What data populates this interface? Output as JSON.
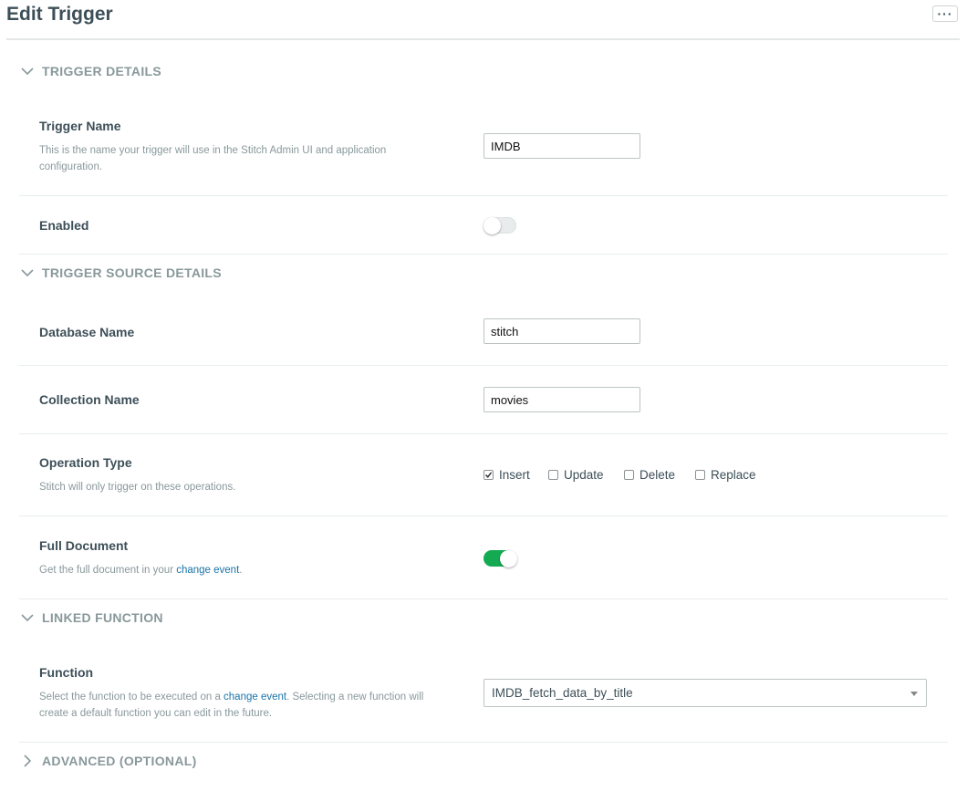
{
  "header": {
    "title": "Edit Trigger",
    "more_label": "···"
  },
  "sections": {
    "trigger_details": "TRIGGER DETAILS",
    "trigger_source": "TRIGGER SOURCE DETAILS",
    "linked_function": "LINKED FUNCTION",
    "advanced": "ADVANCED (OPTIONAL)"
  },
  "trigger_name": {
    "label": "Trigger Name",
    "description": "This is the name your trigger will use in the Stitch Admin UI and application configuration.",
    "value": "IMDB"
  },
  "enabled": {
    "label": "Enabled",
    "on": false
  },
  "database_name": {
    "label": "Database Name",
    "value": "stitch"
  },
  "collection_name": {
    "label": "Collection Name",
    "value": "movies"
  },
  "operation_type": {
    "label": "Operation Type",
    "description": "Stitch will only trigger on these operations.",
    "options": [
      {
        "label": "Insert",
        "checked": true
      },
      {
        "label": "Update",
        "checked": false
      },
      {
        "label": "Delete",
        "checked": false
      },
      {
        "label": "Replace",
        "checked": false
      }
    ]
  },
  "full_document": {
    "label": "Full Document",
    "description_prefix": "Get the full document in your ",
    "link_text": "change event",
    "description_suffix": ".",
    "on": true
  },
  "function": {
    "label": "Function",
    "description_prefix": "Select the function to be executed on a ",
    "link_text": "change event",
    "description_suffix": ". Selecting a new function will create a default function you can edit in the future.",
    "selected": "IMDB_fetch_data_by_title"
  },
  "colors": {
    "accent_green": "#13aa52",
    "link_blue": "#1a73a8",
    "text_dark": "#3d4f58",
    "text_muted": "#89989b"
  }
}
